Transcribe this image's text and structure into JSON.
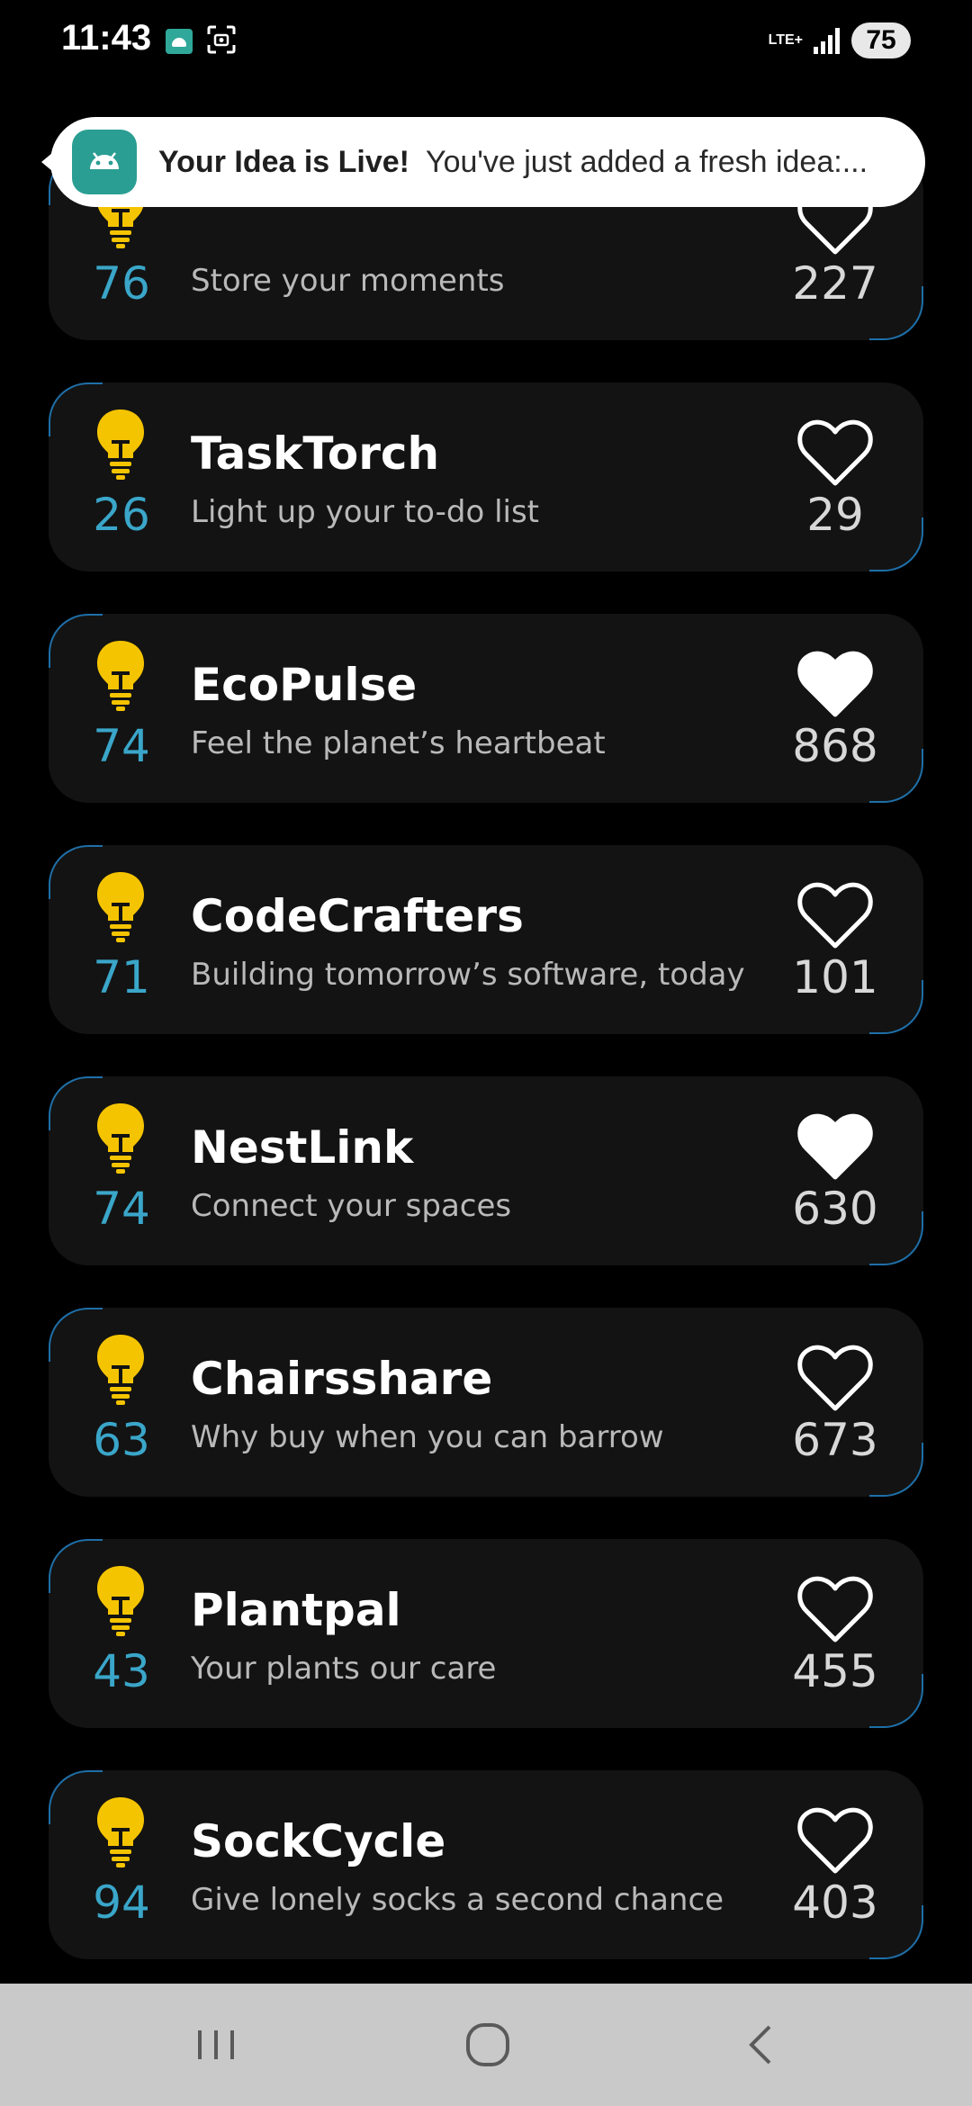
{
  "status_bar": {
    "time": "11:43",
    "network": "LTE+",
    "battery": "75"
  },
  "notification": {
    "title": "Your Idea is Live!",
    "text": "You've just added a fresh idea:..."
  },
  "ideas": [
    {
      "score": "76",
      "title": "",
      "subtitle": "Store your moments",
      "likes": "227",
      "liked": false
    },
    {
      "score": "26",
      "title": "TaskTorch",
      "subtitle": "Light up your to-do list",
      "likes": "29",
      "liked": false
    },
    {
      "score": "74",
      "title": "EcoPulse",
      "subtitle": "Feel the planet’s heartbeat",
      "likes": "868",
      "liked": true
    },
    {
      "score": "71",
      "title": "CodeCrafters",
      "subtitle": "Building tomorrow’s software, today",
      "likes": "101",
      "liked": false
    },
    {
      "score": "74",
      "title": "NestLink",
      "subtitle": "Connect your spaces",
      "likes": "630",
      "liked": true
    },
    {
      "score": "63",
      "title": "Chairsshare",
      "subtitle": "Why buy when you can barrow",
      "likes": "673",
      "liked": false
    },
    {
      "score": "43",
      "title": "Plantpal",
      "subtitle": "Your plants our care",
      "likes": "455",
      "liked": false
    },
    {
      "score": "94",
      "title": "SockCycle",
      "subtitle": "Give lonely socks a second chance",
      "likes": "403",
      "liked": false
    }
  ],
  "colors": {
    "bulb": "#f5c400",
    "score": "#3aa6c9",
    "card": "#131313",
    "accent_border": "#1e6fa8"
  },
  "icons": {
    "idea": "lightbulb-icon",
    "like": "heart-icon",
    "nav_recents": "recents-icon",
    "nav_home": "home-icon",
    "nav_back": "back-icon"
  }
}
